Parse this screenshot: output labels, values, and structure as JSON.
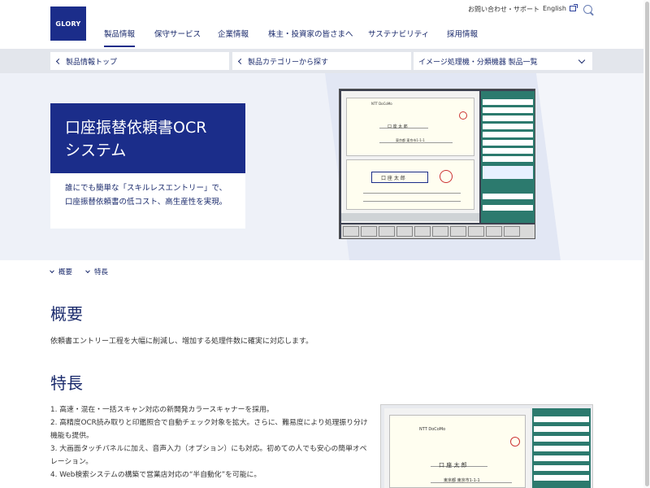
{
  "brand": {
    "logo_text": "GLORY"
  },
  "utility": {
    "contact": "お問い合わせ・サポート",
    "english": "English"
  },
  "global_nav": [
    {
      "label": "製品情報",
      "active": true
    },
    {
      "label": "保守サービス"
    },
    {
      "label": "企業情報"
    },
    {
      "label": "株主・投資家の皆さまへ"
    },
    {
      "label": "サステナビリティ"
    },
    {
      "label": "採用情報"
    }
  ],
  "sub_nav": {
    "back_top": "製品情報トップ",
    "back_category": "製品カテゴリーから探す",
    "list_dropdown": "イメージ処理機・分類機器 製品一覧"
  },
  "hero": {
    "title_line1": "口座振替依頼書OCR",
    "title_line2": "システム",
    "desc": "誰にでも簡単な「スキルレスエントリー」で、口座振替依頼書の低コスト、高生産性を実現。"
  },
  "anchor_nav": [
    {
      "label": "概要"
    },
    {
      "label": "特長"
    }
  ],
  "overview": {
    "heading": "概要",
    "text": "依頼書エントリー工程を大幅に削減し、増加する処理件数に確実に対応します。"
  },
  "features": {
    "heading": "特長",
    "items": [
      "1. 高速・混在・一括スキャン対応の新開発カラースキャナーを採用。",
      "2. 高精度OCR読み取りと印鑑照合で自動チェック対象を拡大。さらに、難易度により処理振り分け機能も提供。",
      "3. 大画面タッチパネルに加え、音声入力（オプション）にも対応。初めての人でも安心の簡単オペレーション。",
      "4. Web検索システムの構築で営業店対応の“半自動化”を可能に。"
    ]
  },
  "screenshot": {
    "company": "NTT DoCoMo",
    "name_field": "口 座 太 郎",
    "address": "東京都 東京市1-1-1"
  },
  "colors": {
    "brand_navy": "#1b2d8a",
    "hero_bg": "#eef1f8",
    "subnav_bg": "#e3e6ec"
  }
}
